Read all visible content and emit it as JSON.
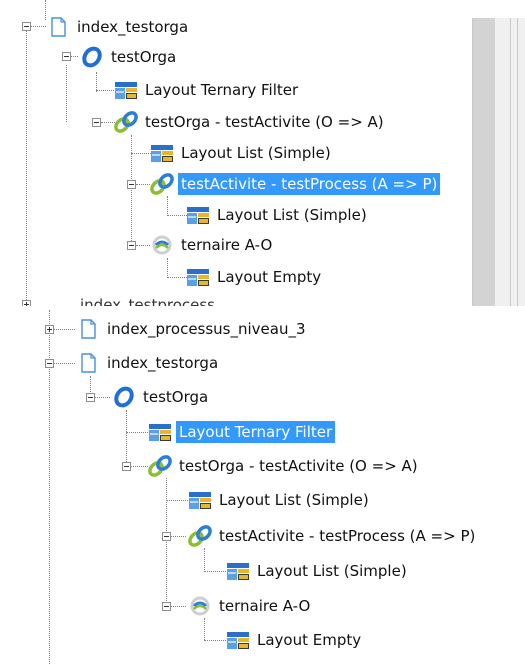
{
  "panelA": {
    "nodes": {
      "index_testorga": "index_testorga",
      "testOrga": "testOrga",
      "layout_ternary_filter": "Layout Ternary Filter",
      "link_orga_activite": "testOrga - testActivite (O => A)",
      "layout_list_1": "Layout List (Simple)",
      "link_activite_process": "testActivite - testProcess (A => P)",
      "layout_list_2": "Layout List (Simple)",
      "ternaire": "ternaire A-O",
      "layout_empty": "Layout Empty",
      "cut_next": "index_testprocess"
    },
    "selected": "testActivite - testProcess (A => P)"
  },
  "panelB": {
    "nodes": {
      "index_processus": "index_processus_niveau_3",
      "index_testorga": "index_testorga",
      "testOrga": "testOrga",
      "layout_ternary_filter": "Layout Ternary Filter",
      "link_orga_activite": "testOrga - testActivite (O => A)",
      "layout_list_1": "Layout List (Simple)",
      "link_activite_process": "testActivite - testProcess (A => P)",
      "layout_list_2": "Layout List (Simple)",
      "ternaire": "ternaire A-O",
      "layout_empty": "Layout Empty"
    },
    "selected": "Layout Ternary Filter"
  },
  "colors": {
    "selection": "#3399ff",
    "orga_ring": "#1f6fd6",
    "link_green": "#8cbf2f",
    "link_blue": "#2a7fd4",
    "layout_blue": "#2a6fc9",
    "layout_yellow": "#e7b62a"
  },
  "icons": [
    "document-icon",
    "orga-ring-icon",
    "layout-icon",
    "link-icon",
    "ternary-icon"
  ]
}
